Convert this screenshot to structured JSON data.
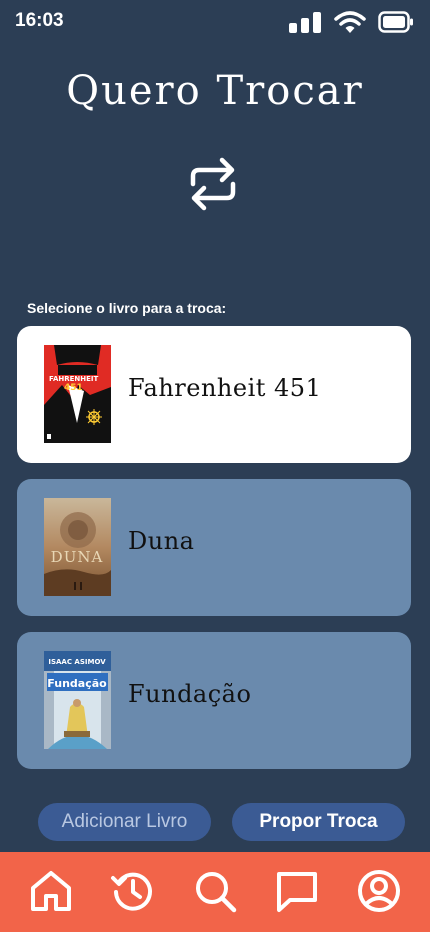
{
  "status_bar": {
    "time": "16:03",
    "icons": [
      "signal-icon",
      "wifi-icon",
      "battery-icon"
    ]
  },
  "header": {
    "title": "Quero Trocar",
    "icon": "swap-arrows-icon"
  },
  "section": {
    "label": "Selecione o livro para a troca:"
  },
  "books": [
    {
      "title": "Fahrenheit 451",
      "selected": true
    },
    {
      "title": "Duna",
      "selected": false
    },
    {
      "title": "Fundação",
      "selected": false
    }
  ],
  "actions": {
    "add_label": "Adicionar Livro",
    "propose_label": "Propor Troca"
  },
  "nav": {
    "items": [
      "home-icon",
      "history-icon",
      "search-icon",
      "chat-icon",
      "profile-icon"
    ]
  },
  "colors": {
    "background": "#2c3e55",
    "card": "#6a8aad",
    "card_selected": "#ffffff",
    "button": "#3b5b94",
    "nav": "#f26449"
  }
}
